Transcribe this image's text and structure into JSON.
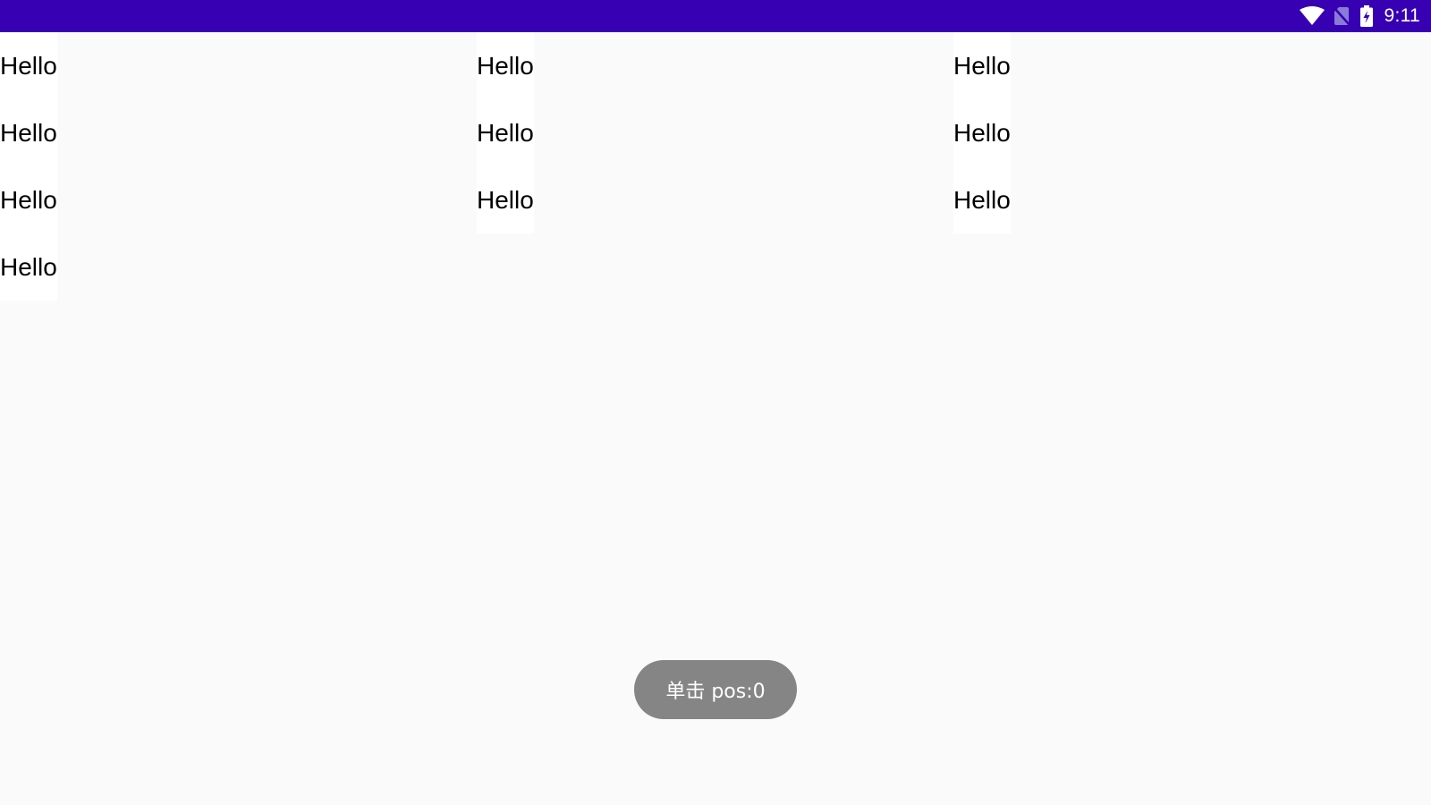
{
  "status_bar": {
    "time": "9:11",
    "icons": [
      "wifi-icon",
      "no-sim-icon",
      "battery-charging-icon"
    ],
    "background_color": "#3700b3"
  },
  "grid": {
    "columns": [
      {
        "items": [
          "Hello",
          "Hello",
          "Hello",
          "Hello"
        ]
      },
      {
        "items": [
          "Hello",
          "Hello",
          "Hello"
        ]
      },
      {
        "items": [
          "Hello",
          "Hello",
          "Hello"
        ]
      }
    ]
  },
  "toast": {
    "text": "单击 pos:0"
  }
}
